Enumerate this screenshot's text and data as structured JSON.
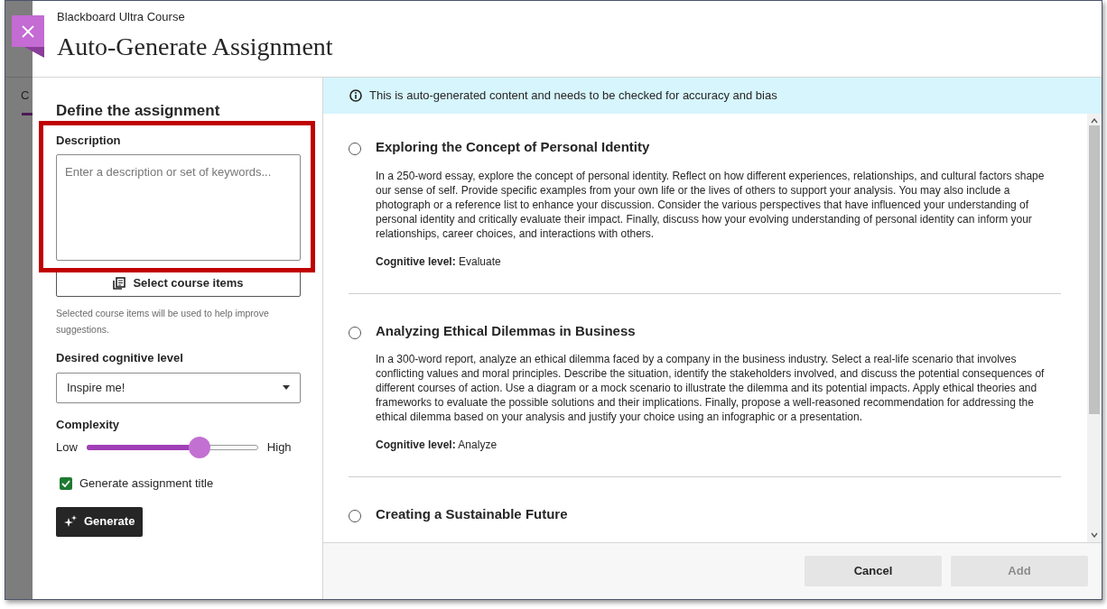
{
  "background_page": {
    "tab_label": "C"
  },
  "header": {
    "course": "Blackboard Ultra Course",
    "title": "Auto-Generate Assignment"
  },
  "form": {
    "heading": "Define the assignment",
    "description": {
      "label": "Description",
      "placeholder": "Enter a description or set of keywords..."
    },
    "select_items": {
      "label": "Select course items",
      "hint": "Selected course items will be used to help improve suggestions."
    },
    "cognitive": {
      "label": "Desired cognitive level",
      "value": "Inspire me!"
    },
    "complexity": {
      "label": "Complexity",
      "low": "Low",
      "high": "High",
      "level": 0.66
    },
    "generate_title": {
      "label": "Generate assignment title",
      "checked": true
    },
    "generate_button": "Generate"
  },
  "banner": "This is auto-generated content and needs to be checked for accuracy and bias",
  "suggestions": [
    {
      "title": "Exploring the Concept of Personal Identity",
      "selected": false,
      "body": "In a 250-word essay, explore the concept of personal identity. Reflect on how different experiences, relationships, and cultural factors shape our sense of self. Provide specific examples from your own life or the lives of others to support your analysis. You may also include a photograph or a reference list to enhance your discussion. Consider the various perspectives that have influenced your understanding of personal identity and critically evaluate their impact. Finally, discuss how your evolving understanding of personal identity can inform your relationships, career choices, and interactions with others.",
      "level_label": "Cognitive level:",
      "level": "Evaluate"
    },
    {
      "title": "Analyzing Ethical Dilemmas in Business",
      "selected": false,
      "body": "In a 300-word report, analyze an ethical dilemma faced by a company in the business industry. Select a real-life scenario that involves conflicting values and moral principles. Describe the situation, identify the stakeholders involved, and discuss the potential consequences of different courses of action. Use a diagram or a mock scenario to illustrate the dilemma and its potential impacts. Apply ethical theories and frameworks to evaluate the possible solutions and their implications. Finally, propose a well-reasoned recommendation for addressing the ethical dilemma based on your analysis and justify your choice using an infographic or a presentation.",
      "level_label": "Cognitive level:",
      "level": "Analyze"
    },
    {
      "title": "Creating a Sustainable Future",
      "selected": false
    }
  ],
  "footer": {
    "buttons": [
      {
        "label": "Cancel",
        "disabled": false
      },
      {
        "label": "Add",
        "disabled": true
      }
    ]
  }
}
